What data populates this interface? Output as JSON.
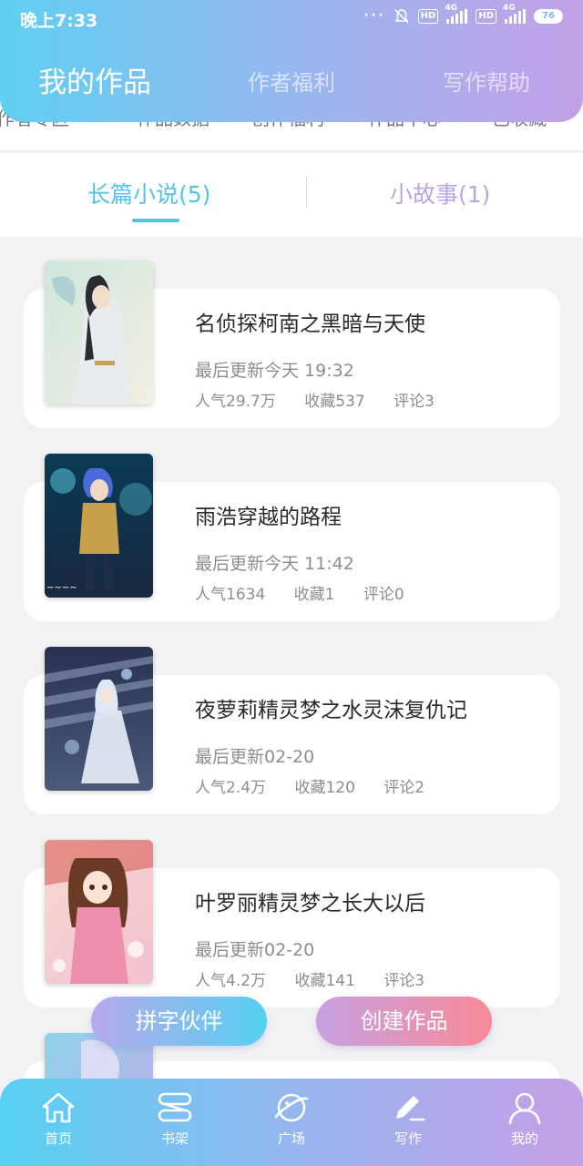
{
  "status_bar": {
    "time": "晚上7:33",
    "network_1": "4G",
    "network_2": "4G",
    "hd_1": "HD",
    "hd_2": "HD",
    "battery": "76"
  },
  "top_tabs": [
    "我的作品",
    "作者福利",
    "写作帮助"
  ],
  "hidden_strip": [
    "作者专区",
    "作品数据",
    "创作福利",
    "作品中心",
    "已收藏"
  ],
  "sub_tabs": {
    "novels": "长篇小说(5)",
    "stories": "小故事(1)"
  },
  "books": [
    {
      "title": "名侦探柯南之黑暗与天使",
      "updated": "最后更新今天 19:32",
      "popularity": "人气29.7万",
      "favorites": "收藏537",
      "comments": "评论3"
    },
    {
      "title": "雨浩穿越的路程",
      "updated": "最后更新今天 11:42",
      "popularity": "人气1634",
      "favorites": "收藏1",
      "comments": "评论0"
    },
    {
      "title": "夜萝莉精灵梦之水灵沫复仇记",
      "updated": "最后更新02-20",
      "popularity": "人气2.4万",
      "favorites": "收藏120",
      "comments": "评论2"
    },
    {
      "title": "叶罗丽精灵梦之长大以后",
      "updated": "最后更新02-20",
      "popularity": "人气4.2万",
      "favorites": "收藏141",
      "comments": "评论3"
    },
    {
      "title": "",
      "updated": "",
      "popularity": "",
      "favorites": "",
      "comments": ""
    }
  ],
  "actions": {
    "partner": "拼字伙伴",
    "create": "创建作品"
  },
  "bottom_nav": [
    {
      "label": "首页",
      "icon": "home-icon"
    },
    {
      "label": "书架",
      "icon": "bookshelf-icon"
    },
    {
      "label": "广场",
      "icon": "planet-icon"
    },
    {
      "label": "写作",
      "icon": "pen-icon"
    },
    {
      "label": "我的",
      "icon": "user-icon"
    }
  ],
  "colors": {
    "accent_blue": "#55c3e8",
    "accent_purple": "#b8a3e6",
    "accent_pink": "#f88a97"
  }
}
